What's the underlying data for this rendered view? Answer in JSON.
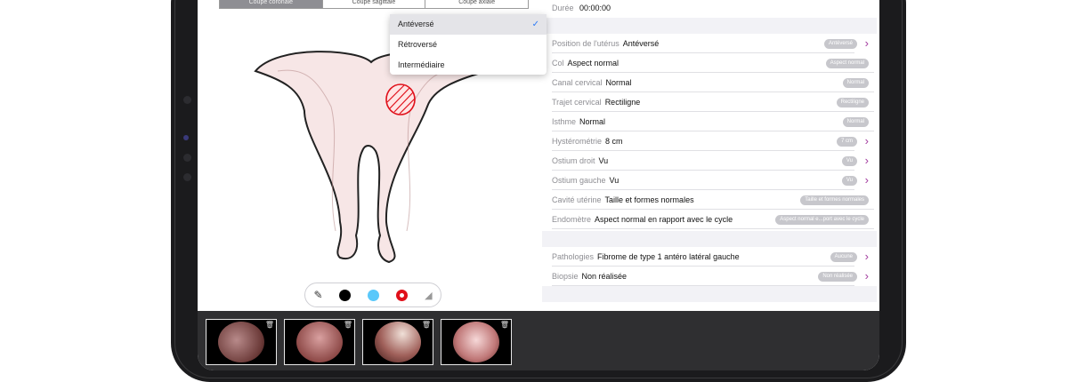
{
  "segmented": [
    "Coupe coronale",
    "Coupe sagittale",
    "Coupe axiale"
  ],
  "duration": {
    "label": "Durée",
    "value": "00:00:00"
  },
  "dropdown": {
    "options": [
      "Antéversé",
      "Rétroversé",
      "Intermédiaire"
    ],
    "selected": "Antéversé"
  },
  "rows": [
    {
      "label": "Position de l'utérus",
      "value": "Antéversé",
      "pill": "Antéversé",
      "chevron": true
    },
    {
      "label": "Col",
      "value": "Aspect normal",
      "pill": "Aspect normal",
      "chevron": false
    },
    {
      "label": "Canal cervical",
      "value": "Normal",
      "pill": "Normal",
      "chevron": false
    },
    {
      "label": "Trajet cervical",
      "value": "Rectiligne",
      "pill": "Rectiligne",
      "chevron": false
    },
    {
      "label": "Isthme",
      "value": "Normal",
      "pill": "Normal",
      "chevron": false
    },
    {
      "label": "Hystérométrie",
      "value": "8 cm",
      "pill": "7 cm",
      "chevron": true
    },
    {
      "label": "Ostium droit",
      "value": "Vu",
      "pill": "Vu",
      "chevron": true
    },
    {
      "label": "Ostium gauche",
      "value": "Vu",
      "pill": "Vu",
      "chevron": true
    },
    {
      "label": "Cavité utérine",
      "value": "Taille et formes normales",
      "pill": "Taille et formes normales",
      "chevron": false
    },
    {
      "label": "Endomètre",
      "value": "Aspect normal en rapport avec le cycle",
      "pill": "Aspect normal e...port avec le cycle",
      "chevron": false
    }
  ],
  "rows2": [
    {
      "label": "Pathologies",
      "value": "Fibrome de type 1 antéro latéral gauche",
      "pill": "Aucune",
      "chevron": true
    },
    {
      "label": "Biopsie",
      "value": "Non réalisée",
      "pill": "Non réalisée",
      "chevron": true
    }
  ],
  "tools": [
    "eraser-icon",
    "black",
    "light-blue",
    "red",
    "brush-off-icon"
  ],
  "colors": {
    "black": "#000000",
    "blue": "#5ac8fa",
    "red": "#e0101a",
    "chevron": "#a23b9e",
    "pill": "#c7c7cc"
  },
  "thumbnails": 4
}
